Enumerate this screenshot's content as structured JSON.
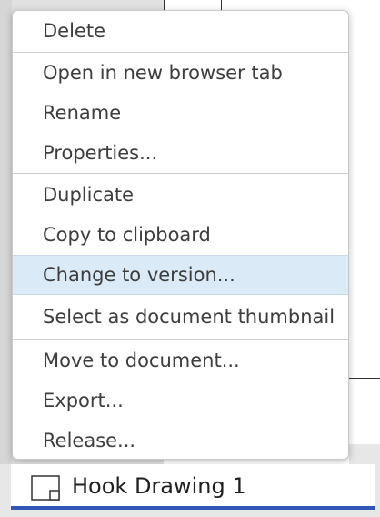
{
  "context_menu": {
    "items": [
      {
        "label": "Delete"
      },
      {
        "label": "Open in new browser tab"
      },
      {
        "label": "Rename"
      },
      {
        "label": "Properties..."
      },
      {
        "label": "Duplicate"
      },
      {
        "label": "Copy to clipboard"
      },
      {
        "label": "Change to version..."
      },
      {
        "label": "Select as document thumbnail"
      },
      {
        "label": "Move to document..."
      },
      {
        "label": "Export..."
      },
      {
        "label": "Release..."
      }
    ],
    "highlighted_item": "Change to version..."
  },
  "tab": {
    "label": "Hook Drawing 1",
    "icon": "drawing-icon",
    "active": true
  },
  "colors": {
    "highlight_bg": "#dbeaf7",
    "tab_underline": "#2f57b3",
    "menu_text": "#3d3d3d"
  }
}
